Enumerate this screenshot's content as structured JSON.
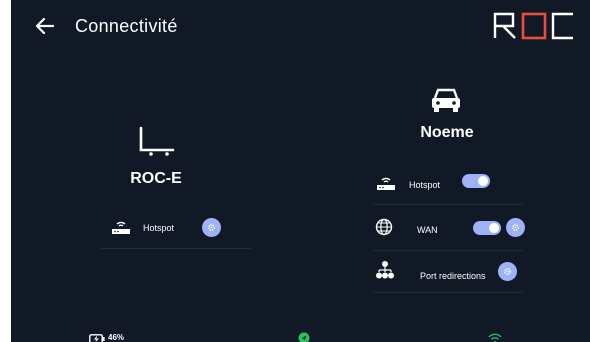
{
  "header": {
    "title": "Connectivité",
    "back_icon": "arrow-left-icon",
    "logo_text": "ROC"
  },
  "left_device": {
    "icon": "cart-icon",
    "name": "ROC-E",
    "items": [
      {
        "icon": "router-icon",
        "label": "Hotspot",
        "has_toggle": false,
        "has_settings": true
      }
    ]
  },
  "right_device": {
    "icon": "car-icon",
    "name": "Noeme",
    "items": [
      {
        "icon": "router-icon",
        "label": "Hotspot",
        "toggle_on": true,
        "has_settings": false
      },
      {
        "icon": "globe-icon",
        "label": "WAN",
        "toggle_on": true,
        "has_settings": true
      },
      {
        "icon": "network-tree-icon",
        "label": "Port redirections",
        "has_toggle": false,
        "has_settings": true
      }
    ]
  },
  "status_bar": {
    "battery_icon": "battery-charging-icon",
    "battery_text": "46%",
    "gps_icon": "gps-icon",
    "wifi_icon": "wifi-icon"
  },
  "colors": {
    "background": "#111826",
    "accent": "#9db2f7",
    "logo_red": "#e8503a",
    "status_green": "#22c55e"
  }
}
